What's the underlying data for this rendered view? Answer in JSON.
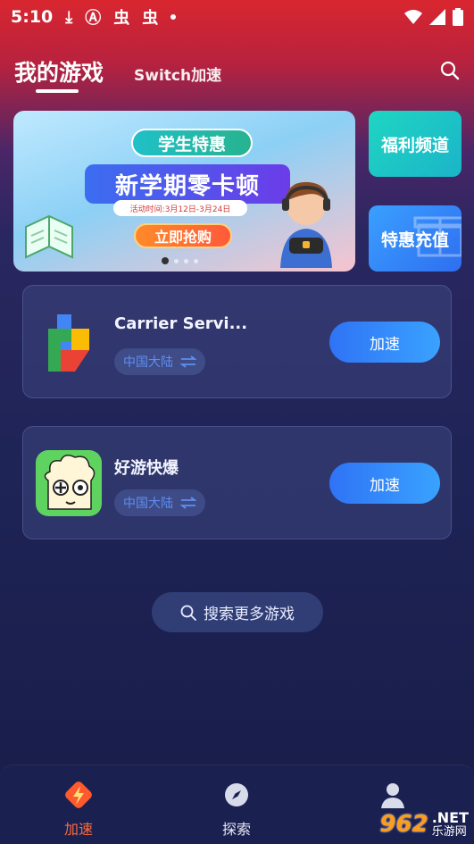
{
  "status_bar": {
    "time": "5:10",
    "left_icons": [
      "download-icon",
      "app-a-icon",
      "bug-icon",
      "bug-icon"
    ],
    "right_icons": [
      "wifi-icon",
      "signal-icon",
      "battery-icon"
    ]
  },
  "header": {
    "tab_main": "我的游戏",
    "tab_switch": "Switch加速",
    "search_icon": "search-icon"
  },
  "banner": {
    "badge": "学生特惠",
    "headline": "新学期零卡顿",
    "date_line": "活动时间:3月12日-3月24日",
    "cta": "立即抢购",
    "pager_count": 4,
    "pager_active": 0
  },
  "side_cards": {
    "welfare": "福利频道",
    "topup": "特惠充值"
  },
  "games": [
    {
      "name": "Carrier Servi...",
      "region": "中国大陆",
      "button": "加速",
      "icon": "google-play-services-icon"
    },
    {
      "name": "好游快爆",
      "region": "中国大陆",
      "button": "加速",
      "icon": "haoyou-kuaibao-icon"
    }
  ],
  "more_search": {
    "label": "搜索更多游戏",
    "icon": "search-icon"
  },
  "bottom_nav": {
    "items": [
      {
        "label": "加速",
        "icon": "lightning-icon",
        "active": true
      },
      {
        "label": "探索",
        "icon": "compass-icon",
        "active": false
      },
      {
        "label": "",
        "icon": "user-icon",
        "active": false
      }
    ]
  },
  "watermark": {
    "number": "962",
    "net": ".NET",
    "cn": "乐游网"
  },
  "colors": {
    "accent_blue": "#2f73f5",
    "active_nav": "#ff6a3a",
    "region_text": "#5e8ef2",
    "header_red": "#d9262f"
  }
}
